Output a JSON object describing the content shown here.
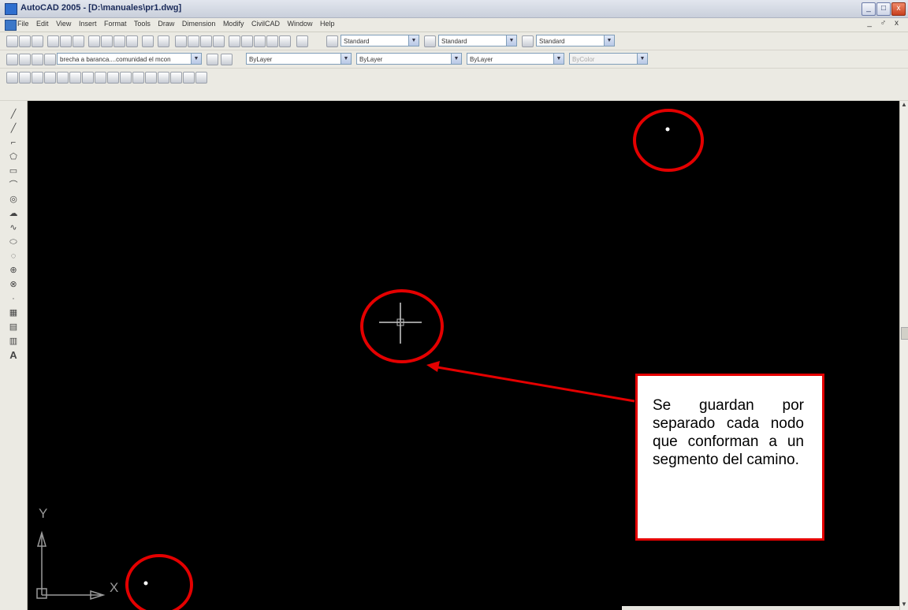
{
  "window": {
    "title": "AutoCAD 2005 - [D:\\manuales\\pr1.dwg]",
    "controls": [
      "_",
      "□",
      "x"
    ]
  },
  "menubar": {
    "items": [
      "File",
      "Edit",
      "View",
      "Insert",
      "Format",
      "Tools",
      "Draw",
      "Dimension",
      "Modify",
      "CivilCAD",
      "Window",
      "Help"
    ],
    "mdi_controls": "_ ♂ x"
  },
  "styles_toolbar": {
    "text_style": "Standard",
    "dim_style": "Standard",
    "table_style": "Standard"
  },
  "layers_toolbar": {
    "current_layer": "brecha a baranca....comunidad el mcon"
  },
  "properties_toolbar": {
    "color": "ByLayer",
    "linetype": "ByLayer",
    "lineweight": "ByLayer",
    "plotstyle": "ByColor"
  },
  "draw_toolbar": {
    "text_tool_label": "A"
  },
  "ucs_icon": {
    "x_label": "X",
    "y_label": "Y"
  },
  "annotation": {
    "callout_text": "Se guardan por separado cada nodo que conforman a un segmento del camino.",
    "highlight_color": "#e40000"
  }
}
